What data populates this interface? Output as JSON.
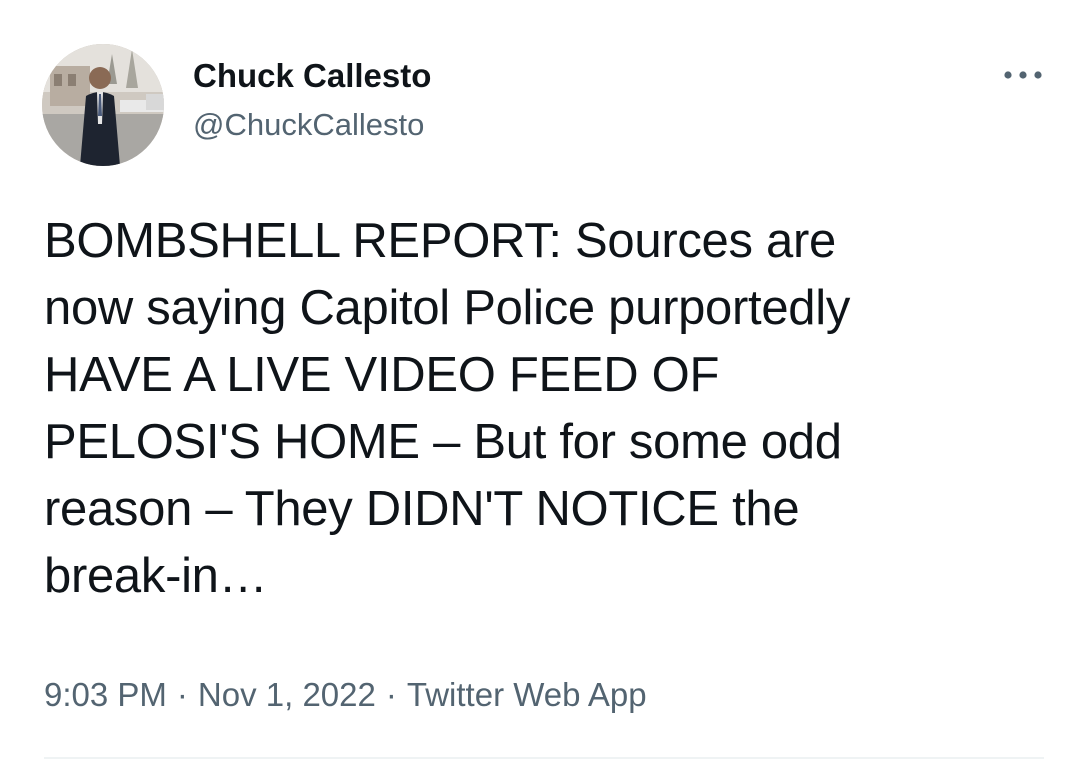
{
  "author": {
    "display_name": "Chuck Callesto",
    "handle": "@ChuckCallesto",
    "avatar_icon": "profile-photo"
  },
  "more_icon": "more-dots-icon",
  "tweet": {
    "text": "BOMBSHELL REPORT: Sources are\nnow saying Capitol Police purportedly\nHAVE A LIVE VIDEO FEED OF\nPELOSI'S HOME – But for some odd\nreason – They DIDN'T NOTICE the\nbreak-in…"
  },
  "meta": {
    "time": "9:03 PM",
    "separator": "·",
    "date": "Nov 1, 2022",
    "source": "Twitter Web App"
  },
  "colors": {
    "text": "#0f1419",
    "secondary": "#536471",
    "divider": "#eff3f4"
  }
}
